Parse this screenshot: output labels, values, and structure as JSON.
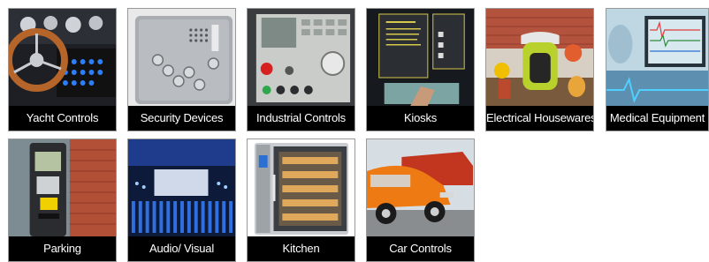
{
  "tiles": [
    {
      "label": "Yacht Controls",
      "icon": "yacht-helm-photo"
    },
    {
      "label": "Security Devices",
      "icon": "security-panel-photo"
    },
    {
      "label": "Industrial Controls",
      "icon": "industrial-panel-photo"
    },
    {
      "label": "Kiosks",
      "icon": "kiosk-photo"
    },
    {
      "label": "Electrical Housewares",
      "icon": "juicer-photo"
    },
    {
      "label": "Medical Equipment",
      "icon": "medical-monitor-photo"
    },
    {
      "label": "Parking",
      "icon": "parking-meter-photo"
    },
    {
      "label": "Audio/ Visual",
      "icon": "mixing-desk-photo"
    },
    {
      "label": "Kitchen",
      "icon": "oven-photo"
    },
    {
      "label": "Car Controls",
      "icon": "classic-car-photo"
    }
  ]
}
